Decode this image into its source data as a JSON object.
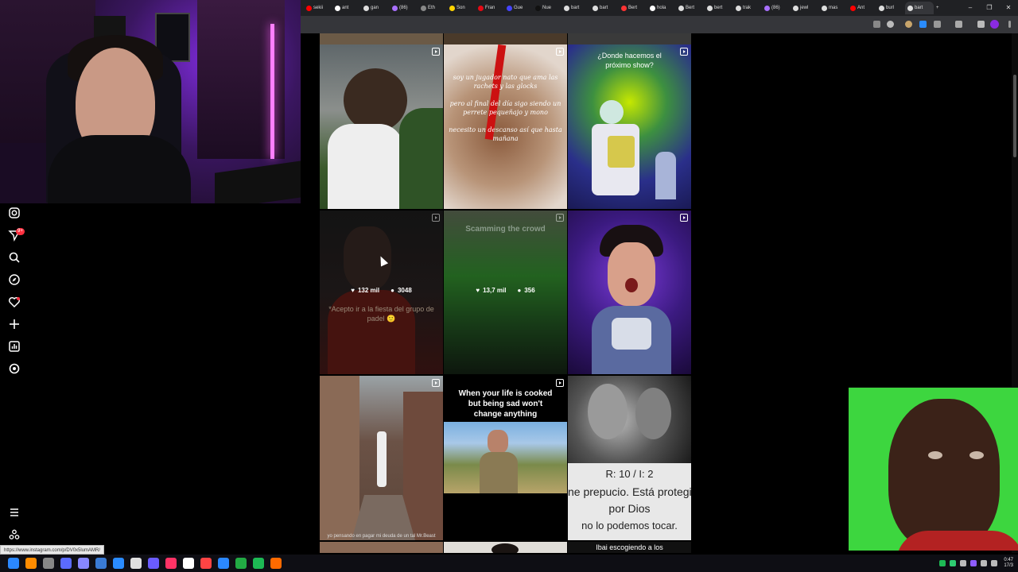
{
  "status_url": "https://www.instagram.com/p/DV0x5lumAMR/",
  "browser": {
    "tabs": [
      {
        "label": "sekii",
        "color": "#ff0000"
      },
      {
        "label": "ant",
        "color": "#ffffff"
      },
      {
        "label": "gan",
        "color": "#dddddd"
      },
      {
        "label": "(86)",
        "color": "#a970ff"
      },
      {
        "label": "Eth",
        "color": "#888888"
      },
      {
        "label": "Son",
        "color": "#ffd400"
      },
      {
        "label": "Fran",
        "color": "#e50914"
      },
      {
        "label": "Gue",
        "color": "#4444ff"
      },
      {
        "label": "Nue",
        "color": "#111111"
      },
      {
        "label": "bart",
        "color": "#dddddd"
      },
      {
        "label": "bart",
        "color": "#dddddd"
      },
      {
        "label": "Bert",
        "color": "#ff3333"
      },
      {
        "label": "hola",
        "color": "#ffffff"
      },
      {
        "label": "Bert",
        "color": "#dddddd"
      },
      {
        "label": "bert",
        "color": "#dddddd"
      },
      {
        "label": "trak",
        "color": "#dddddd"
      },
      {
        "label": "(86)",
        "color": "#a970ff"
      },
      {
        "label": "jewl",
        "color": "#dddddd"
      },
      {
        "label": "mas",
        "color": "#dddddd"
      },
      {
        "label": "Ant",
        "color": "#ff0000"
      },
      {
        "label": "burl",
        "color": "#dddddd"
      },
      {
        "label": "bart",
        "color": "#dddddd",
        "active": true
      }
    ],
    "new_tab": "+",
    "win_min": "–",
    "win_max": "❐",
    "win_close": "✕"
  },
  "grid": {
    "row1": {
      "t2_caption": "soy un jugador nato que ama las rachets y las glocks\n\npero al final del día sigo siendo un perrete pequeñajo y mono\n\nnecesito un descanso así que hasta mañana",
      "t3_caption": "¿Donde hacemos el próximo show?"
    },
    "row2": {
      "t1": {
        "likes": "132 mil",
        "comments": "3048",
        "caption": "*Acepto ir a la fiesta del grupo de padel 🙂"
      },
      "t2": {
        "likes": "13,7 mil",
        "comments": "356",
        "caption": "Scamming the crowd"
      }
    },
    "row3": {
      "t1_caption": "yo pensando en pagar mi deuda de un tal Mr.Beast",
      "t2_caption": "When your life is cooked but being sad won't change anything",
      "t3": {
        "score": "R: 10 / I: 2",
        "line1": "ne prepucio. Está protegi",
        "line2": "por Dios",
        "line3": "no lo podemos tocar."
      }
    },
    "row4": {
      "t3_caption": "Ibai escogiendo a los"
    }
  },
  "taskbar": {
    "time": "0:47",
    "date": "17/3"
  }
}
